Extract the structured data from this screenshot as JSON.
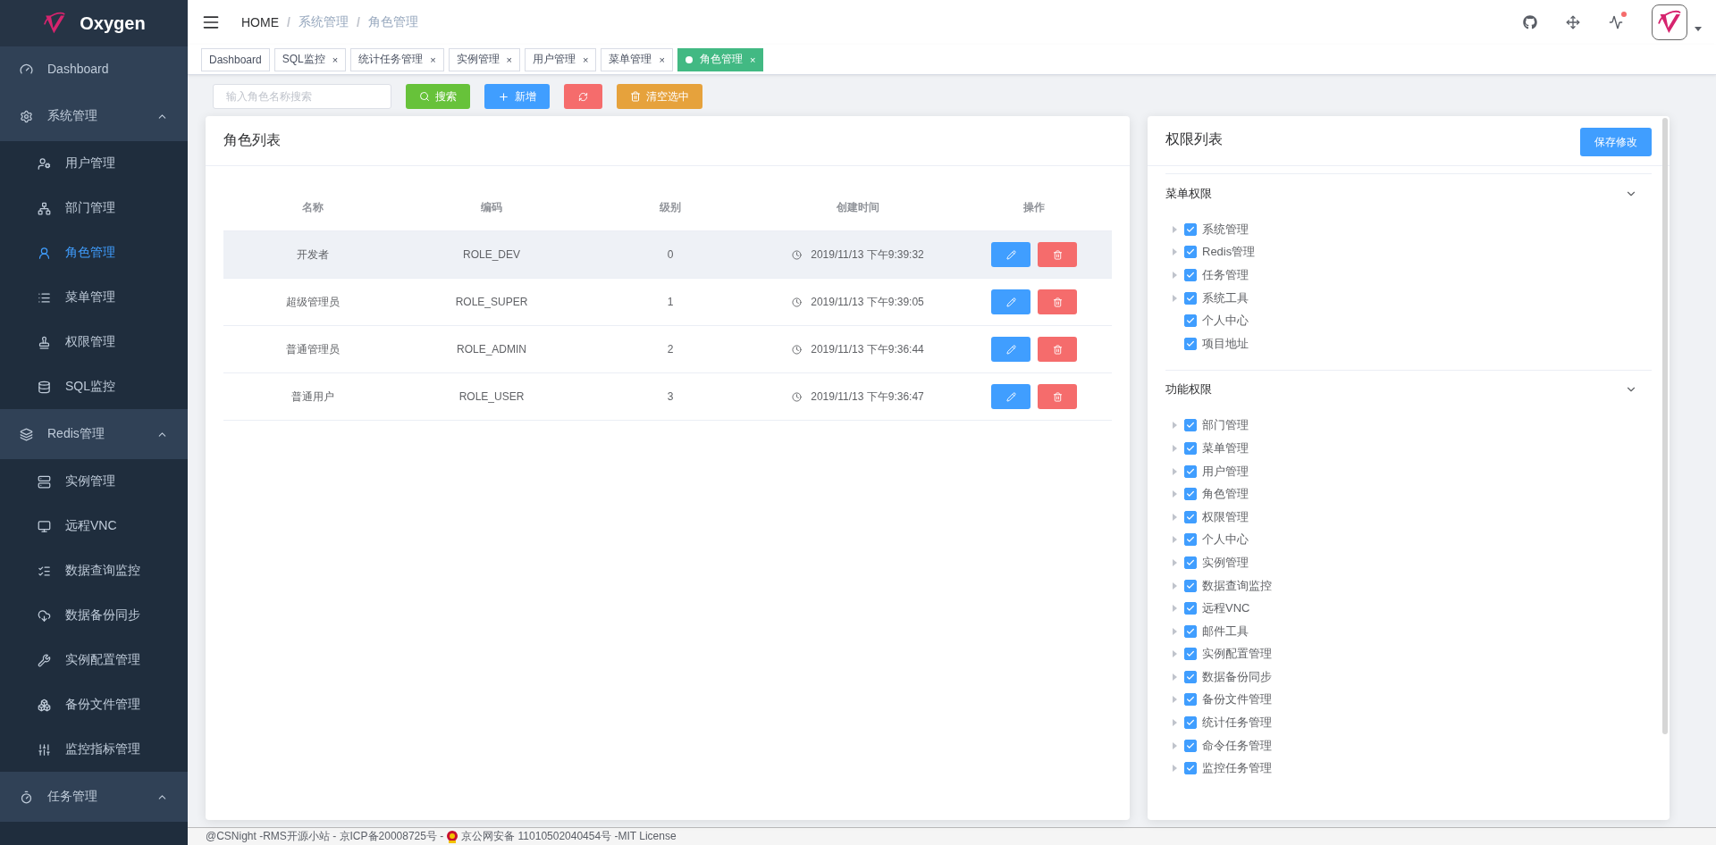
{
  "brand": {
    "name": "Oxygen"
  },
  "sidebar": {
    "items": [
      {
        "kind": "item",
        "label": "Dashboard",
        "selected": false
      },
      {
        "kind": "group",
        "label": "系统管理",
        "expanded": true,
        "children": [
          {
            "label": "用户管理",
            "selected": false
          },
          {
            "label": "部门管理",
            "selected": false
          },
          {
            "label": "角色管理",
            "selected": true
          },
          {
            "label": "菜单管理",
            "selected": false
          },
          {
            "label": "权限管理",
            "selected": false
          },
          {
            "label": "SQL监控",
            "selected": false
          }
        ]
      },
      {
        "kind": "group",
        "label": "Redis管理",
        "expanded": true,
        "children": [
          {
            "label": "实例管理",
            "selected": false
          },
          {
            "label": "远程VNC",
            "selected": false
          },
          {
            "label": "数据查询监控",
            "selected": false
          },
          {
            "label": "数据备份同步",
            "selected": false
          },
          {
            "label": "实例配置管理",
            "selected": false
          },
          {
            "label": "备份文件管理",
            "selected": false
          },
          {
            "label": "监控指标管理",
            "selected": false
          }
        ]
      },
      {
        "kind": "group",
        "label": "任务管理",
        "expanded": true
      }
    ]
  },
  "breadcrumb": {
    "items": [
      "HOME",
      "系统管理",
      "角色管理"
    ],
    "separators": [
      "/",
      "/"
    ]
  },
  "header_actions": {
    "notification": true
  },
  "tabs": [
    {
      "label": "Dashboard",
      "selected": false,
      "closable": false
    },
    {
      "label": "SQL监控",
      "selected": false,
      "closable": true,
      "close": "×"
    },
    {
      "label": "统计任务管理",
      "selected": false,
      "closable": true,
      "close": "×"
    },
    {
      "label": "实例管理",
      "selected": false,
      "closable": true,
      "close": "×"
    },
    {
      "label": "用户管理",
      "selected": false,
      "closable": true,
      "close": "×"
    },
    {
      "label": "菜单管理",
      "selected": false,
      "closable": true,
      "close": "×"
    },
    {
      "label": "角色管理",
      "selected": true,
      "closable": true,
      "close": "×"
    }
  ],
  "toolbar": {
    "search": {
      "placeholder": "输入角色名称搜索"
    },
    "buttons": [
      {
        "kind": "search",
        "label": "搜索"
      },
      {
        "kind": "add",
        "label": "新增"
      },
      {
        "kind": "refresh"
      },
      {
        "kind": "clear",
        "label": "清空选中"
      }
    ]
  },
  "role_list": {
    "title": "角色列表",
    "columns": [
      "名称",
      "编码",
      "级别",
      "创建时间",
      "操作"
    ],
    "rows": [
      {
        "name": "开发者",
        "code": "ROLE_DEV",
        "level_text": "0",
        "created": "2019/11/13 下午9:39:32",
        "selected": true
      },
      {
        "name": "超级管理员",
        "code": "ROLE_SUPER",
        "level_text": "1",
        "created": "2019/11/13 下午9:39:05",
        "selected": false
      },
      {
        "name": "普通管理员",
        "code": "ROLE_ADMIN",
        "level_text": "2",
        "created": "2019/11/13 下午9:36:44",
        "selected": false
      },
      {
        "name": "普通用户",
        "code": "ROLE_USER",
        "level_text": "3",
        "created": "2019/11/13 下午9:36:47",
        "selected": false
      }
    ]
  },
  "permission_list": {
    "title": "权限列表",
    "save_button": "保存修改",
    "sections": [
      {
        "title": "菜单权限",
        "expanded": true,
        "items": [
          {
            "label": "系统管理",
            "checked": true,
            "expandable": true
          },
          {
            "label": "Redis管理",
            "checked": true,
            "expandable": true
          },
          {
            "label": "任务管理",
            "checked": true,
            "expandable": true
          },
          {
            "label": "系统工具",
            "checked": true,
            "expandable": true
          },
          {
            "label": "个人中心",
            "checked": true,
            "expandable": false
          },
          {
            "label": "项目地址",
            "checked": true,
            "expandable": false
          }
        ]
      },
      {
        "title": "功能权限",
        "expanded": true,
        "items": [
          {
            "label": "部门管理",
            "checked": true,
            "expandable": true
          },
          {
            "label": "菜单管理",
            "checked": true,
            "expandable": true
          },
          {
            "label": "用户管理",
            "checked": true,
            "expandable": true
          },
          {
            "label": "角色管理",
            "checked": true,
            "expandable": true
          },
          {
            "label": "权限管理",
            "checked": true,
            "expandable": true
          },
          {
            "label": "个人中心",
            "checked": true,
            "expandable": true
          },
          {
            "label": "实例管理",
            "checked": true,
            "expandable": true
          },
          {
            "label": "数据查询监控",
            "checked": true,
            "expandable": true
          },
          {
            "label": "远程VNC",
            "checked": true,
            "expandable": true
          },
          {
            "label": "邮件工具",
            "checked": true,
            "expandable": true
          },
          {
            "label": "实例配置管理",
            "checked": true,
            "expandable": true
          },
          {
            "label": "数据备份同步",
            "checked": true,
            "expandable": true
          },
          {
            "label": "备份文件管理",
            "checked": true,
            "expandable": true
          },
          {
            "label": "统计任务管理",
            "checked": true,
            "expandable": true
          },
          {
            "label": "命令任务管理",
            "checked": true,
            "expandable": true
          },
          {
            "label": "监控任务管理",
            "checked": true,
            "expandable": true
          }
        ]
      }
    ]
  },
  "footer": {
    "text_before": "@CSNight -RMS开源小站 - 京ICP备20008725号 -",
    "text_after": "京公网安备 11010502040454号 -MIT License"
  }
}
